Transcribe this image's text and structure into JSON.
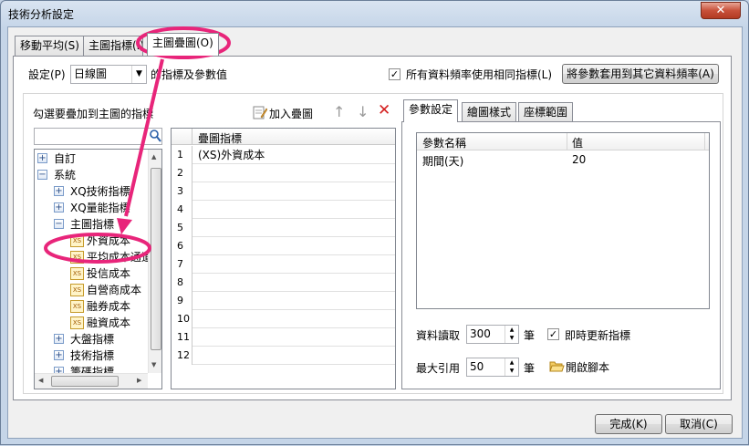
{
  "window": {
    "title": "技術分析設定",
    "close_label": "✕"
  },
  "tabs": [
    {
      "label": "移動平均(S)"
    },
    {
      "label": "主圖指標(I)"
    },
    {
      "label": "主圖疊圖(O)"
    }
  ],
  "setting": {
    "label": "設定(P)",
    "selected": "日線圖",
    "suffix": "的指標及參數值",
    "same_indicator_label": "所有資料頻率使用相同指標(L)",
    "same_indicator_checked": true,
    "apply_button": "將參數套用到其它資料頻率(A)"
  },
  "left_panel": {
    "heading": "勾選要疊加到主圖的指標",
    "search_placeholder": "",
    "tree": [
      {
        "label": "自訂",
        "level": 0,
        "type": "folder",
        "expanded": false
      },
      {
        "label": "系統",
        "level": 0,
        "type": "folder",
        "expanded": true
      },
      {
        "label": "XQ技術指標",
        "level": 1,
        "type": "folder",
        "expanded": false
      },
      {
        "label": "XQ量能指標",
        "level": 1,
        "type": "folder",
        "expanded": false
      },
      {
        "label": "主圖指標",
        "level": 1,
        "type": "folder",
        "expanded": true
      },
      {
        "label": "外資成本",
        "level": 2,
        "type": "item"
      },
      {
        "label": "平均成本通道",
        "level": 2,
        "type": "item"
      },
      {
        "label": "投信成本",
        "level": 2,
        "type": "item"
      },
      {
        "label": "自營商成本",
        "level": 2,
        "type": "item"
      },
      {
        "label": "融券成本",
        "level": 2,
        "type": "item"
      },
      {
        "label": "融資成本",
        "level": 2,
        "type": "item"
      },
      {
        "label": "大盤指標",
        "level": 1,
        "type": "folder",
        "expanded": false
      },
      {
        "label": "技術指標",
        "level": 1,
        "type": "folder",
        "expanded": false
      },
      {
        "label": "籌碼指標",
        "level": 1,
        "type": "folder",
        "expanded": false
      }
    ],
    "item_icon_text": "XS"
  },
  "middle_panel": {
    "add_button": "加入疊圖",
    "grid_header": "疊圖指標",
    "rows": [
      {
        "num": "1",
        "value": "(XS)外資成本"
      },
      {
        "num": "2",
        "value": ""
      },
      {
        "num": "3",
        "value": ""
      },
      {
        "num": "4",
        "value": ""
      },
      {
        "num": "5",
        "value": ""
      },
      {
        "num": "6",
        "value": ""
      },
      {
        "num": "7",
        "value": ""
      },
      {
        "num": "8",
        "value": ""
      },
      {
        "num": "9",
        "value": ""
      },
      {
        "num": "10",
        "value": ""
      },
      {
        "num": "11",
        "value": ""
      },
      {
        "num": "12",
        "value": ""
      }
    ]
  },
  "right_panel": {
    "tabs": [
      {
        "label": "參數設定"
      },
      {
        "label": "繪圖樣式"
      },
      {
        "label": "座標範圍"
      }
    ],
    "param_headers": {
      "name": "參數名稱",
      "value": "值"
    },
    "params": [
      {
        "name": "期間(天)",
        "value": "20"
      }
    ],
    "data_read_label": "資料讀取",
    "data_read_value": "300",
    "data_read_unit": "筆",
    "realtime_label": "即時更新指標",
    "realtime_checked": true,
    "max_ref_label": "最大引用",
    "max_ref_value": "50",
    "max_ref_unit": "筆",
    "open_script_label": "開啟腳本"
  },
  "footer": {
    "ok_button": "完成(K)",
    "cancel_button": "取消(C)"
  },
  "colors": {
    "annotation": "#e8257a",
    "delete_red": "#d42020"
  }
}
